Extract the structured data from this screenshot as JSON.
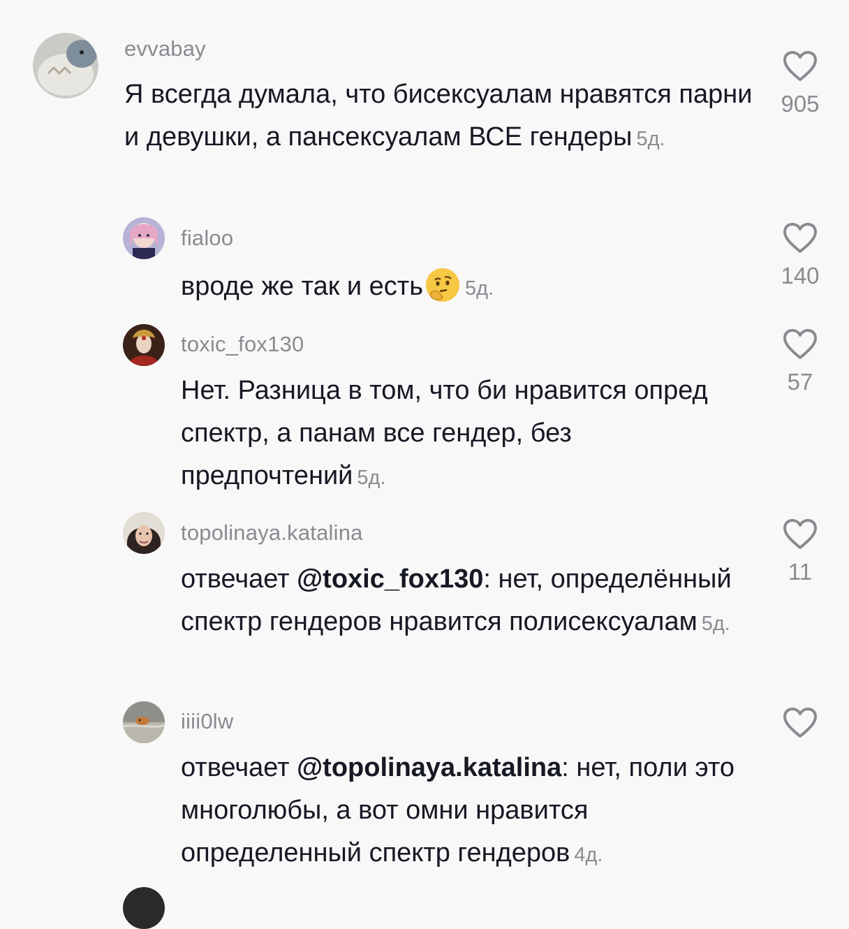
{
  "comments": [
    {
      "username": "evvabay",
      "text": "Я всегда думала, что бисексуалам нравятся парни и девушки, а пансексуалам ВСЕ гендеры",
      "age": "5д.",
      "likes": "905"
    },
    {
      "username": "fialoo",
      "text": "вроде же так и есть",
      "age": "5д.",
      "likes": "140",
      "emoji": "thinking-face"
    },
    {
      "username": "toxic_fox130",
      "text": "Нет. Разница в том, что би нравится опред спектр, а панам все гендер, без предпочтений",
      "age": "5д.",
      "likes": "57"
    },
    {
      "username": "topolinaya.katalina",
      "reply_prefix": "отвечает ",
      "mention": "@toxic_fox130",
      "text": ": нет, определённый спектр гендеров нравится полисексуалам",
      "age": "5д.",
      "likes": "11"
    },
    {
      "username": "iiii0lw",
      "reply_prefix": "отвечает ",
      "mention": "@topolinaya.katalina",
      "text": ": нет, поли это многолюбы, а вот омни нравится определенный спектр гендеров",
      "age": "4д.",
      "likes": ""
    }
  ],
  "colors": {
    "background": "#f8f8f8",
    "text": "#161823",
    "muted": "#8a8b91"
  }
}
